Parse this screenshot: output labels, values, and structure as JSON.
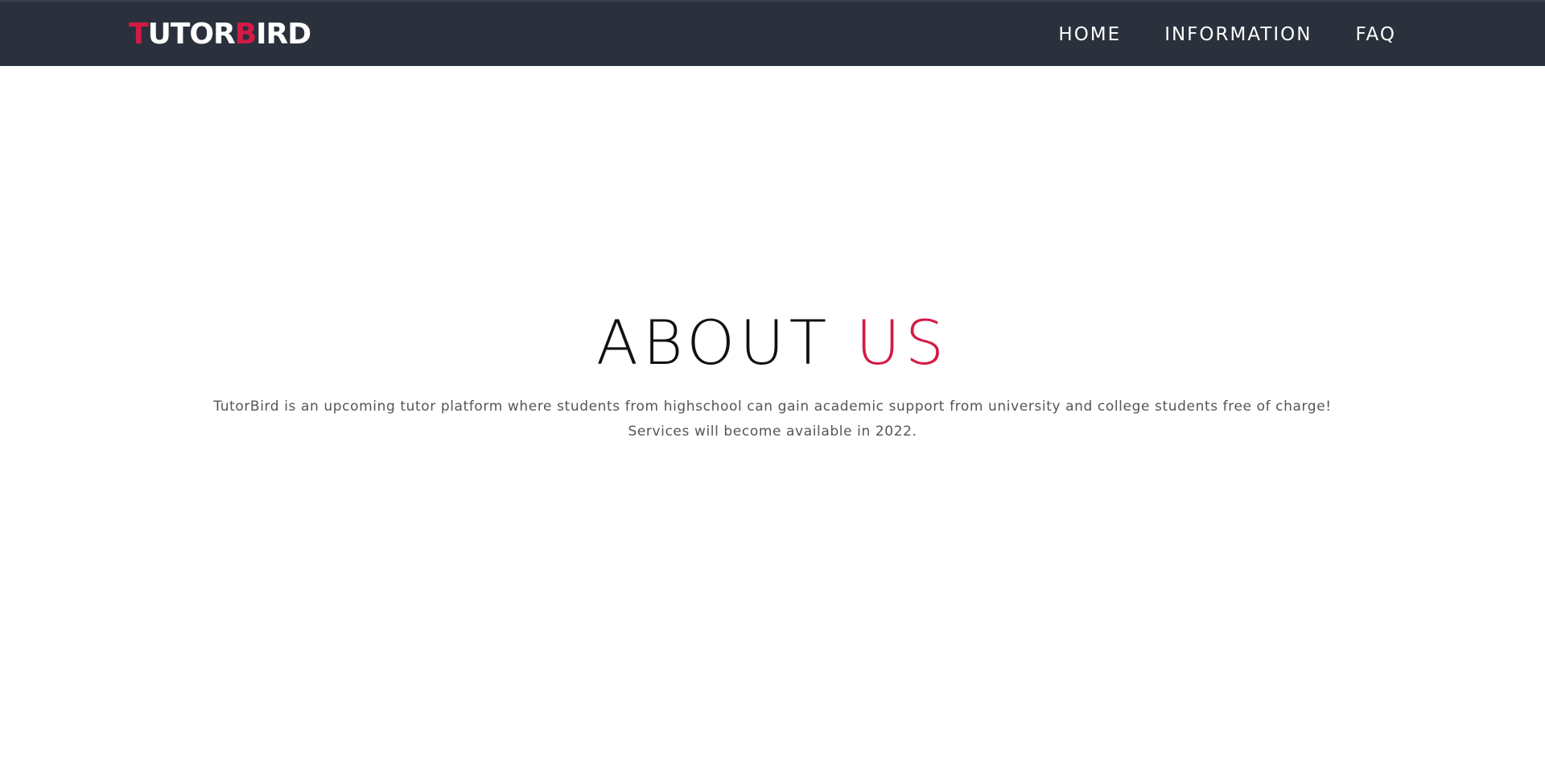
{
  "header": {
    "logo": {
      "part1_accent": "T",
      "part1_rest": "UTOR",
      "part2_accent": "B",
      "part2_rest": "IRD"
    },
    "nav": [
      {
        "label": "HOME"
      },
      {
        "label": "INFORMATION"
      },
      {
        "label": "FAQ"
      }
    ]
  },
  "about": {
    "title_main": "ABOUT ",
    "title_accent": "US",
    "line1": "TutorBird is an upcoming tutor platform where students from highschool can gain academic support from university and college students free of charge!",
    "line2": "Services will become available in 2022."
  },
  "colors": {
    "navbar_bg": "#2a313c",
    "accent": "#d41a45",
    "text": "#111111",
    "body_text": "#555555"
  }
}
